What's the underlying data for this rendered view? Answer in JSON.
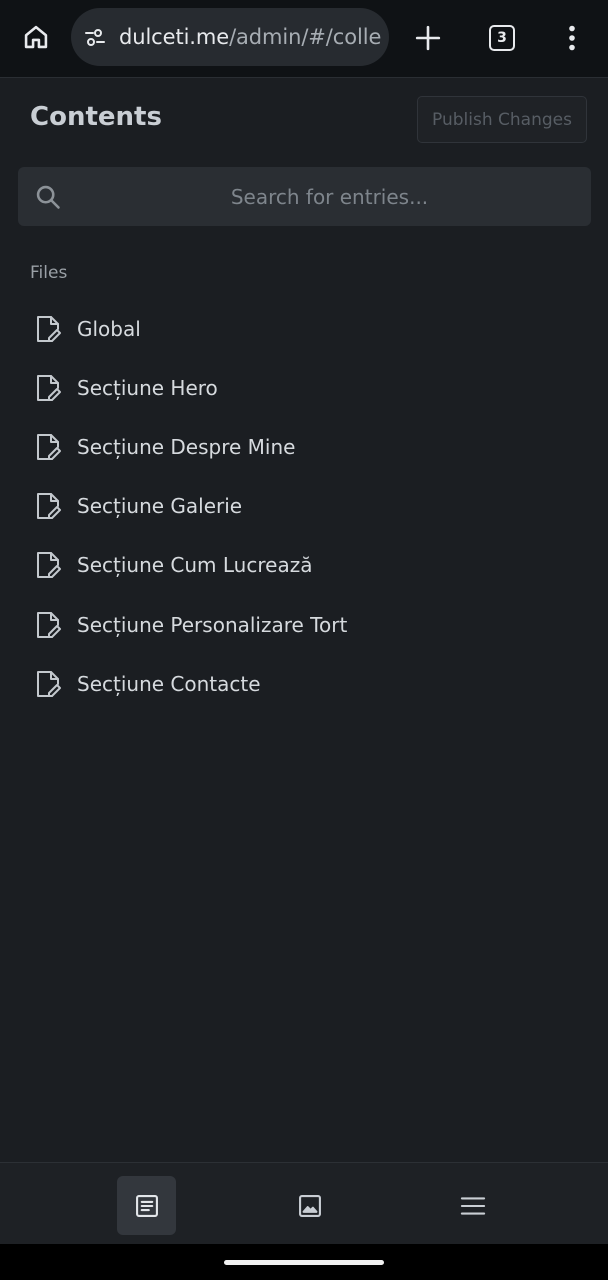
{
  "browser": {
    "url_host": "dulceti.me",
    "url_path": "/admin/#/colle",
    "tab_count": "3",
    "icons": [
      "home-icon",
      "site-settings-icon",
      "plus-icon",
      "tabs-icon",
      "more-vert-icon"
    ]
  },
  "header": {
    "title": "Contents",
    "publish_label": "Publish Changes"
  },
  "search": {
    "placeholder": "Search for entries...",
    "value": ""
  },
  "files": {
    "section_label": "Files",
    "items": [
      {
        "label": "Global"
      },
      {
        "label": "Secțiune Hero"
      },
      {
        "label": "Secțiune Despre Mine"
      },
      {
        "label": "Secțiune Galerie"
      },
      {
        "label": "Secțiune Cum Lucrează"
      },
      {
        "label": "Secțiune Personalizare Tort"
      },
      {
        "label": "Secțiune Contacte"
      }
    ]
  },
  "bottom_nav": {
    "items": [
      {
        "icon": "entries-icon",
        "active": true
      },
      {
        "icon": "media-icon",
        "active": false
      },
      {
        "icon": "menu-icon",
        "active": false
      }
    ]
  },
  "colors": {
    "background": "#1b1e22",
    "browser_bar": "#0f1215",
    "search_bg": "#2a2e33",
    "text": "#d6dade"
  }
}
